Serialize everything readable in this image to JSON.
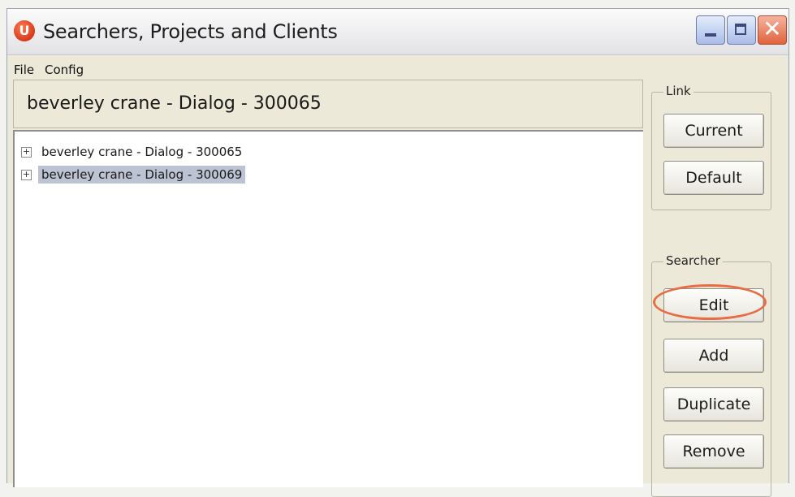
{
  "window": {
    "title": "Searchers, Projects and Clients",
    "app_icon": "app-logo-icon",
    "controls": {
      "minimize": "minimize-icon",
      "maximize": "maximize-icon",
      "close": "close-icon",
      "close_glyph": "✕"
    }
  },
  "menu": {
    "file": "File",
    "config": "Config"
  },
  "header": {
    "text": "beverley crane - Dialog - 300065"
  },
  "tree": {
    "items": [
      {
        "expander": "+",
        "label": "beverley crane - Dialog - 300065",
        "selected": false
      },
      {
        "expander": "+",
        "label": "beverley crane - Dialog - 300069",
        "selected": true
      }
    ]
  },
  "link_group": {
    "legend": "Link",
    "current": "Current",
    "default": "Default"
  },
  "searcher_group": {
    "legend": "Searcher",
    "edit": "Edit",
    "add": "Add",
    "duplicate": "Duplicate",
    "remove": "Remove"
  },
  "colors": {
    "highlight_ring": "#e86d45",
    "selection": "#bcc3d2"
  }
}
